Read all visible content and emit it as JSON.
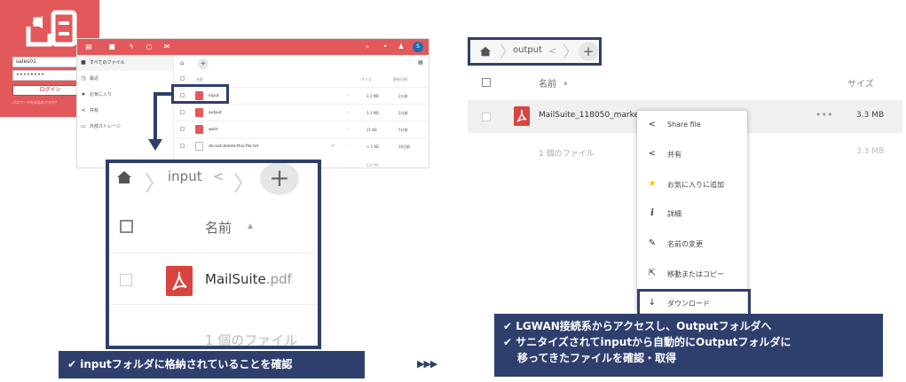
{
  "login": {
    "username": "sales01",
    "password_mask": "••••••••",
    "login_button": "ログイン",
    "forgot_text": "パスワードをお忘れですか？"
  },
  "small_screen": {
    "sidebar": [
      {
        "label": "すべてのファイル",
        "icon": "folder-icon"
      },
      {
        "label": "最近",
        "icon": "clock-icon"
      },
      {
        "label": "お気に入り",
        "icon": "star-icon"
      },
      {
        "label": "共有",
        "icon": "share-icon"
      },
      {
        "label": "外部ストレージ",
        "icon": "external-storage-icon"
      }
    ],
    "headers": {
      "name": "名前",
      "size": "サイズ",
      "modified": "更新日時"
    },
    "rows": [
      {
        "name": "input",
        "size": "3.3 MB",
        "modified": "2分前"
      },
      {
        "name": "output",
        "size": "3.3 MB",
        "modified": "2分前"
      },
      {
        "name": "work",
        "size": "31 KB",
        "modified": "5分前"
      },
      {
        "name": "do-not-delete-this-file.txt",
        "size": "< 1 KB",
        "modified": "10日前"
      }
    ],
    "summary_size": "6.6 MB",
    "avatar_letter": "S"
  },
  "zoom_panel": {
    "breadcrumb": "input",
    "header_name": "名前",
    "file_base": "MailSuite",
    "file_ext": ".pdf",
    "count_text": "1 個のファイル"
  },
  "right_screen": {
    "breadcrumb": "output",
    "header_name": "名前",
    "header_size": "サイズ",
    "file_name": "MailSuite_118050_marke",
    "file_size": "3.3 MB",
    "count_text": "1 個のファイル",
    "summary_size": "3.3 MB"
  },
  "context_menu": [
    {
      "label": "Share file",
      "icon": "share-icon"
    },
    {
      "label": "共有",
      "icon": "share-icon"
    },
    {
      "label": "お気に入りに追加",
      "icon": "star-icon"
    },
    {
      "label": "詳細",
      "icon": "info-icon"
    },
    {
      "label": "名前の変更",
      "icon": "pencil-icon"
    },
    {
      "label": "移動またはコピー",
      "icon": "move-icon"
    },
    {
      "label": "ダウンロード",
      "icon": "download-icon"
    }
  ],
  "captions": {
    "left": "inputフォルダに格納されていることを確認",
    "right_line1": "LGWAN接続系からアクセスし、Outputフォルダへ",
    "right_line2": "サニタイズされてinputから自動的にOutputフォルダに",
    "right_line3": "移ってきたファイルを確認・取得",
    "check_mark": "✔",
    "arrows": "▶▶▶"
  },
  "colors": {
    "brand": "#e3585a",
    "highlight": "#2e3f6e",
    "pdf": "#d9443e"
  }
}
